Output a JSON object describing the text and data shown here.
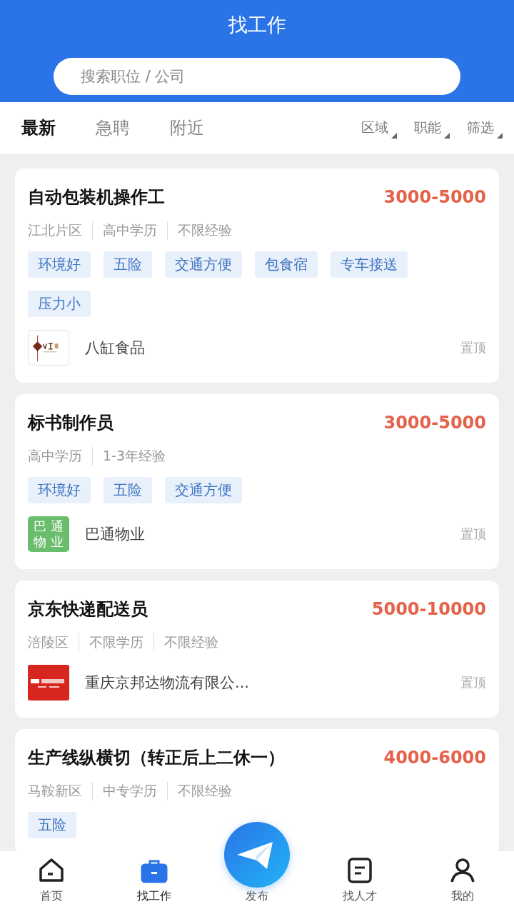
{
  "header": {
    "title": "找工作",
    "search": {
      "placeholder": "搜索职位 / 公司"
    }
  },
  "tabs": [
    {
      "label": "最新",
      "selected": true
    },
    {
      "label": "急聘",
      "selected": false
    },
    {
      "label": "附近",
      "selected": false
    }
  ],
  "filters": [
    "区域",
    "职能",
    "筛选"
  ],
  "jobs": [
    {
      "title": "自动包装机操作工",
      "salary": "3000-5000",
      "meta": [
        "江北片区",
        "高中学历",
        "不限经验"
      ],
      "tags": [
        "环境好",
        "五险",
        "交通方便",
        "包食宿",
        "专车接送",
        "压力小"
      ],
      "company": {
        "name": "八缸食品",
        "logo": {
          "kind": "seal"
        }
      },
      "pin": "置顶"
    },
    {
      "title": "标书制作员",
      "salary": "3000-5000",
      "meta": [
        "高中学历",
        "1-3年经验"
      ],
      "tags": [
        "环境好",
        "五险",
        "交通方便"
      ],
      "company": {
        "name": "巴通物业",
        "logo": {
          "kind": "text",
          "text": "巴通物业"
        }
      },
      "pin": "置顶"
    },
    {
      "title": "京东快递配送员",
      "salary": "5000-10000",
      "meta": [
        "涪陵区",
        "不限学历",
        "不限经验"
      ],
      "company": {
        "name": "重庆京邦达物流有限公...",
        "logo": {
          "kind": "red"
        }
      },
      "pin": "置顶"
    },
    {
      "title": "生产线纵横切（转正后上二休一）",
      "salary": "4000-6000",
      "meta": [
        "马鞍新区",
        "中专学历",
        "不限经验"
      ],
      "tags": [
        "五险"
      ]
    }
  ],
  "nav": [
    {
      "label": "首页",
      "kind": "home",
      "selected": false
    },
    {
      "label": "找工作",
      "kind": "job",
      "selected": true
    },
    {
      "label": "发布",
      "kind": "publish",
      "selected": false
    },
    {
      "label": "找人才",
      "kind": "talent",
      "selected": false
    },
    {
      "label": "我的",
      "kind": "me",
      "selected": false
    }
  ]
}
